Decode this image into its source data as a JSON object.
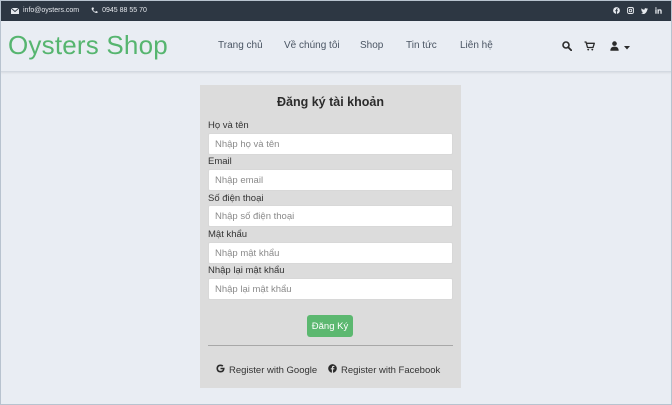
{
  "topbar": {
    "email": "info@oysters.com",
    "phone": "0945 88 55 70",
    "social_icons": [
      "facebook-icon",
      "instagram-icon",
      "twitter-icon",
      "linkedin-icon"
    ]
  },
  "header": {
    "logo": "Oysters Shop",
    "nav": [
      "Trang chủ",
      "Về chúng tôi",
      "Shop",
      "Tin tức",
      "Liên hệ"
    ],
    "tools": [
      "search-icon",
      "cart-icon",
      "user-icon",
      "caret-down-icon"
    ]
  },
  "form": {
    "title": "Đăng ký tài khoản",
    "fields": [
      {
        "label": "Họ và tên",
        "placeholder": "Nhập họ và tên",
        "value": ""
      },
      {
        "label": "Email",
        "placeholder": "Nhập email",
        "value": ""
      },
      {
        "label": "Số điện thoại",
        "placeholder": "Nhập số điện thoại",
        "value": ""
      },
      {
        "label": "Mật khẩu",
        "placeholder": "Nhập mật khẩu",
        "value": ""
      },
      {
        "label": "Nhập lại mật khẩu",
        "placeholder": "Nhập lại mật khẩu",
        "value": ""
      }
    ],
    "submit_label": "Đăng Ký",
    "google_label": "Register with Google",
    "facebook_label": "Register with Facebook"
  },
  "colors": {
    "topbar_bg": "#2d3743",
    "brand_green": "#56b56f",
    "button_green": "#5cb870",
    "page_bg": "#e9edf3",
    "card_bg": "#dcdcdc"
  }
}
